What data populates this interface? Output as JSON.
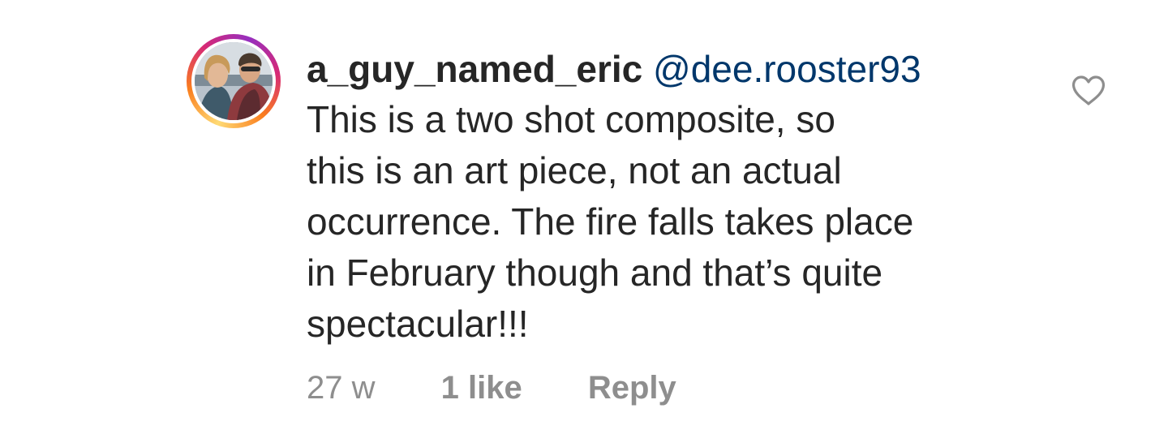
{
  "comment": {
    "username": "a_guy_named_eric",
    "mention": "@dee.rooster93",
    "lines": [
      "This is a two shot composite, so",
      "this is an art piece, not an actual",
      "occurrence. The fire falls takes place",
      "in February though and that’s quite",
      "spectacular!!!"
    ],
    "time": "27 w",
    "likes": "1 like",
    "reply_label": "Reply",
    "like_icon": "heart-outline-icon"
  },
  "colors": {
    "text": "#262626",
    "mention": "#00376b",
    "meta": "#8e8e8e",
    "heart": "#8e8e8e"
  }
}
